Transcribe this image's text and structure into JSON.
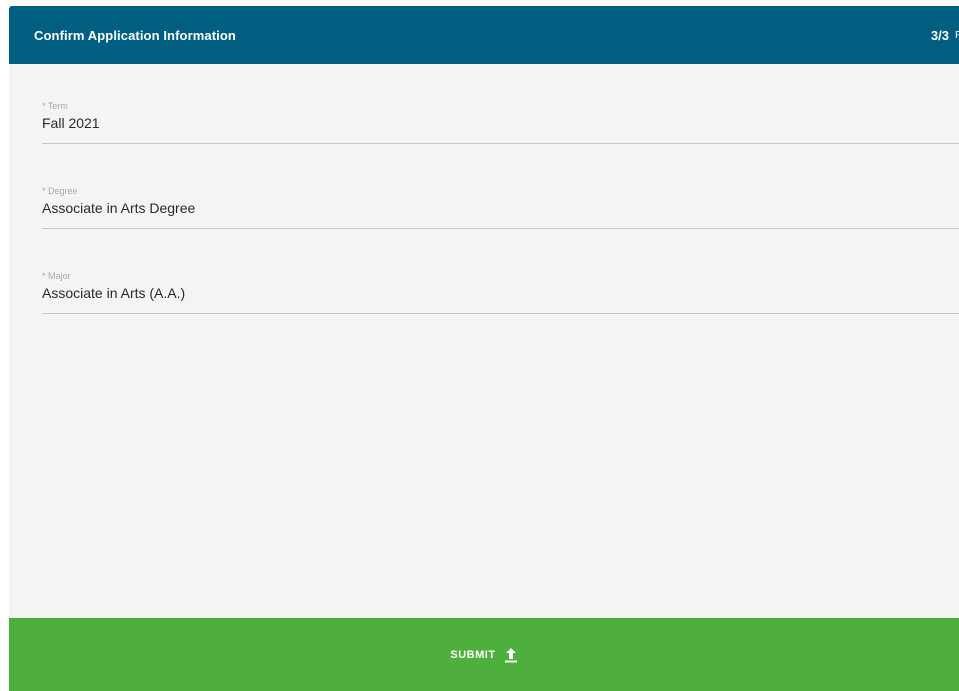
{
  "header": {
    "title": "Confirm Application Information",
    "step": "3/3",
    "cut_text": "F"
  },
  "fields": [
    {
      "label": "* Term",
      "value": "Fall 2021"
    },
    {
      "label": "* Degree",
      "value": "Associate in Arts Degree"
    },
    {
      "label": "* Major",
      "value": "Associate in Arts (A.A.)"
    }
  ],
  "submit": {
    "label": "SUBMIT",
    "icon": "upload-icon"
  },
  "colors": {
    "header_bg": "#005f80",
    "submit_bg": "#4faf3d",
    "body_bg": "#f4f4f4"
  }
}
